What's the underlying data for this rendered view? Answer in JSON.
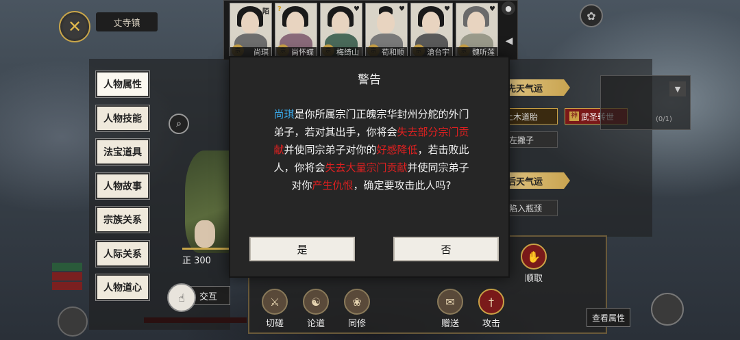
{
  "header": {
    "title": "丈寺镇",
    "close_icon": "crossed-swords-icon"
  },
  "portraits": [
    {
      "name": "尚琪",
      "mark": "陌"
    },
    {
      "name": "尚怀蝶",
      "mark": "?"
    },
    {
      "name": "梅绮山",
      "mark": "♥"
    },
    {
      "name": "荀和顺",
      "mark": "♥"
    },
    {
      "name": "滄台宇",
      "mark": "♥"
    },
    {
      "name": "魏听莲",
      "mark": "♥"
    }
  ],
  "left_menu": [
    {
      "label": "人物属性",
      "active": true
    },
    {
      "label": "人物技能",
      "active": false
    },
    {
      "label": "法宝道具",
      "active": false
    },
    {
      "label": "人物故事",
      "active": false
    },
    {
      "label": "宗族关系",
      "active": false
    },
    {
      "label": "人际关系",
      "active": false
    },
    {
      "label": "人物道心",
      "active": false
    }
  ],
  "character": {
    "stat_text": "正 300",
    "interact_label": "交互"
  },
  "right_panel": {
    "innate_luck": "先天气运",
    "innate_traits": [
      "土木道胎",
      "武圣转世"
    ],
    "innate_mark": "神",
    "trait_plain_1": "左撇子",
    "acquired_luck": "后天气运",
    "trait_plain_2": "陷入瓶颈",
    "counter": "(0/1)"
  },
  "actions": [
    {
      "label": "切磋",
      "icon": "spar-icon"
    },
    {
      "label": "论道",
      "icon": "discuss-icon"
    },
    {
      "label": "同修",
      "icon": "cultivate-icon"
    },
    {
      "label": "赠送",
      "icon": "gift-icon"
    },
    {
      "label": "攻击",
      "icon": "attack-icon"
    },
    {
      "label": "顺取",
      "icon": "steal-icon"
    }
  ],
  "view_attr_label": "查看属性",
  "dialog": {
    "title": "警告",
    "name": "尚琪",
    "seg1": "是你所属宗门正魄宗华封州分舵的外门弟子，若对其出手，你将会",
    "red1": "失去部分宗门贡献",
    "seg2": "并使同宗弟子对你的",
    "red2": "好感降低",
    "seg3": "，若击败此人，你将会",
    "red3": "失去大量宗门贡献",
    "seg4": "并使同宗弟子对你",
    "red4": "产生仇恨",
    "seg5": "，确定要攻击此人吗?",
    "yes_label": "是",
    "no_label": "否"
  }
}
